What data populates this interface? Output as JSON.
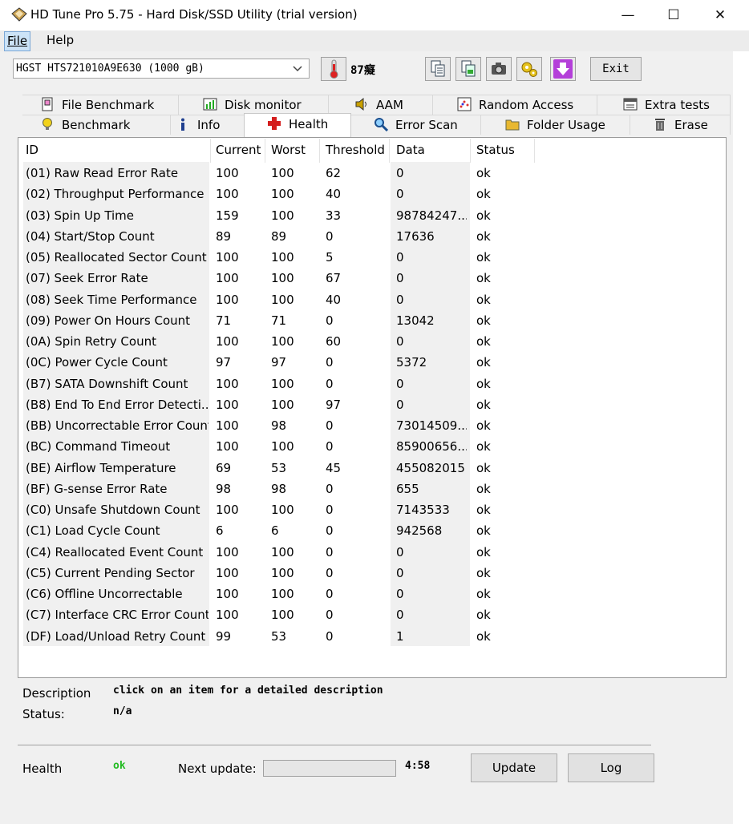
{
  "window": {
    "title": "HD Tune Pro 5.75 - Hard Disk/SSD Utility (trial version)",
    "minimize": "—",
    "maximize": "☐",
    "close": "✕"
  },
  "menu": {
    "file": "File",
    "help": "Help"
  },
  "toolbar": {
    "drive": "HGST HTS721010A9E630 (1000 gB)",
    "temperature": "87癡",
    "exit_label": "Exit"
  },
  "tabs": {
    "row1": [
      {
        "label": "File Benchmark",
        "icon": "file-benchmark-icon"
      },
      {
        "label": "Disk monitor",
        "icon": "disk-monitor-icon"
      },
      {
        "label": "AAM",
        "icon": "speaker-icon"
      },
      {
        "label": "Random Access",
        "icon": "random-access-icon"
      },
      {
        "label": "Extra tests",
        "icon": "extra-tests-icon"
      }
    ],
    "row2": [
      {
        "label": "Benchmark",
        "icon": "lightbulb-icon"
      },
      {
        "label": "Info",
        "icon": "info-icon"
      },
      {
        "label": "Health",
        "icon": "health-cross-icon"
      },
      {
        "label": "Error Scan",
        "icon": "magnifier-icon"
      },
      {
        "label": "Folder Usage",
        "icon": "folder-icon"
      },
      {
        "label": "Erase",
        "icon": "trash-icon"
      }
    ],
    "active": "Health"
  },
  "table": {
    "headers": [
      "ID",
      "Current",
      "Worst",
      "Threshold",
      "Data",
      "Status"
    ],
    "rows": [
      [
        "(01) Raw Read Error Rate",
        "100",
        "100",
        "62",
        "0",
        "ok"
      ],
      [
        "(02) Throughput Performance",
        "100",
        "100",
        "40",
        "0",
        "ok"
      ],
      [
        "(03) Spin Up Time",
        "159",
        "100",
        "33",
        "98784247...",
        "ok"
      ],
      [
        "(04) Start/Stop Count",
        "89",
        "89",
        "0",
        "17636",
        "ok"
      ],
      [
        "(05) Reallocated Sector Count",
        "100",
        "100",
        "5",
        "0",
        "ok"
      ],
      [
        "(07) Seek Error Rate",
        "100",
        "100",
        "67",
        "0",
        "ok"
      ],
      [
        "(08) Seek Time Performance",
        "100",
        "100",
        "40",
        "0",
        "ok"
      ],
      [
        "(09) Power On Hours Count",
        "71",
        "71",
        "0",
        "13042",
        "ok"
      ],
      [
        "(0A) Spin Retry Count",
        "100",
        "100",
        "60",
        "0",
        "ok"
      ],
      [
        "(0C) Power Cycle Count",
        "97",
        "97",
        "0",
        "5372",
        "ok"
      ],
      [
        "(B7) SATA Downshift Count",
        "100",
        "100",
        "0",
        "0",
        "ok"
      ],
      [
        "(B8) End To End Error Detecti...",
        "100",
        "100",
        "97",
        "0",
        "ok"
      ],
      [
        "(BB) Uncorrectable Error Count",
        "100",
        "98",
        "0",
        "73014509...",
        "ok"
      ],
      [
        "(BC) Command Timeout",
        "100",
        "100",
        "0",
        "85900656...",
        "ok"
      ],
      [
        "(BE) Airflow Temperature",
        "69",
        "53",
        "45",
        "455082015",
        "ok"
      ],
      [
        "(BF) G-sense Error Rate",
        "98",
        "98",
        "0",
        "655",
        "ok"
      ],
      [
        "(C0) Unsafe Shutdown Count",
        "100",
        "100",
        "0",
        "7143533",
        "ok"
      ],
      [
        "(C1) Load Cycle Count",
        "6",
        "6",
        "0",
        "942568",
        "ok"
      ],
      [
        "(C4) Reallocated Event Count",
        "100",
        "100",
        "0",
        "0",
        "ok"
      ],
      [
        "(C5) Current Pending Sector",
        "100",
        "100",
        "0",
        "0",
        "ok"
      ],
      [
        "(C6) Offline Uncorrectable",
        "100",
        "100",
        "0",
        "0",
        "ok"
      ],
      [
        "(C7) Interface CRC Error Count",
        "100",
        "100",
        "0",
        "0",
        "ok"
      ],
      [
        "(DF) Load/Unload Retry Count",
        "99",
        "53",
        "0",
        "1",
        "ok"
      ]
    ]
  },
  "details": {
    "description_label": "Description",
    "description_value": "click on an item for a detailed description",
    "status_label": "Status:",
    "status_value": "n/a"
  },
  "footer": {
    "health_label": "Health",
    "health_value": "ok",
    "health_color": "#22bb22",
    "next_update_label": "Next update:",
    "progress": 0,
    "countdown": "4:58",
    "update_label": "Update",
    "log_label": "Log"
  }
}
